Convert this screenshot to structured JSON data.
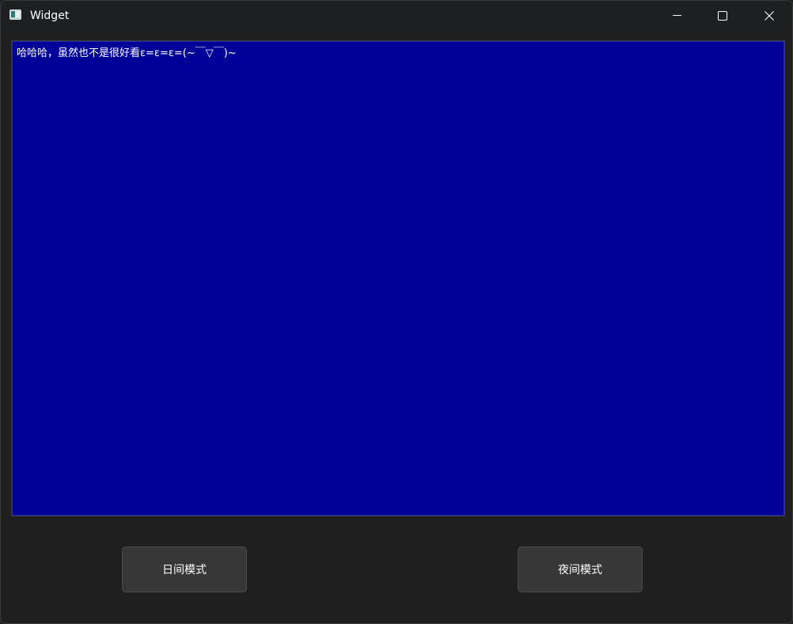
{
  "window": {
    "title": "Widget",
    "icon": "app-window-icon"
  },
  "caption_buttons": {
    "minimize": "minimize-icon",
    "maximize": "maximize-icon",
    "close": "close-icon"
  },
  "editor": {
    "text": "哈哈哈，虽然也不是很好看ε=ε=ε=(~￣▽￣)~",
    "background_color": "#000099",
    "text_color": "#ffffff"
  },
  "buttons": {
    "day_mode_label": "日间模式",
    "night_mode_label": "夜间模式"
  }
}
